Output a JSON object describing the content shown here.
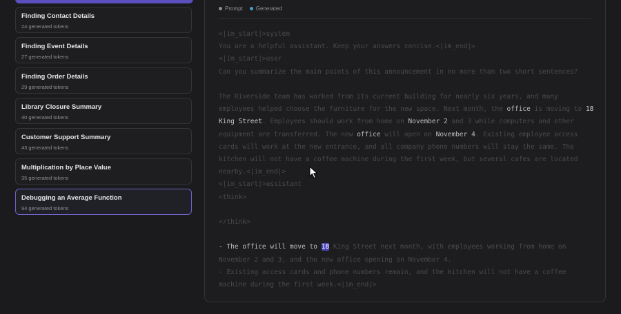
{
  "sidebar": {
    "items": [
      {
        "title": "",
        "subtitle": ""
      },
      {
        "title": "Finding Contact Details",
        "subtitle": "24 generated tokens"
      },
      {
        "title": "Finding Event Details",
        "subtitle": "27 generated tokens"
      },
      {
        "title": "Finding Order Details",
        "subtitle": "29 generated tokens"
      },
      {
        "title": "Library Closure Summary",
        "subtitle": "40 generated tokens"
      },
      {
        "title": "Customer Support Summary",
        "subtitle": "43 generated tokens"
      },
      {
        "title": "Multiplication by Place Value",
        "subtitle": "35 generated tokens"
      },
      {
        "title": "Debugging an Average Function",
        "subtitle": "94 generated tokens"
      }
    ]
  },
  "legend": {
    "prompt": "Prompt",
    "generated": "Generated",
    "prompt_color": "#8e8e93",
    "generated_color": "#3ea6c9"
  },
  "transcript": {
    "l1": "<|im_start|>system",
    "l2": "You are a helpful assistant. Keep your answers concise.<|im_end|>",
    "l3": "<|im_start|>user",
    "l4": "Can you summarize the main points of this announcement in no more than two short sentences?",
    "p1a": "The Riverside team has worked from its current building for nearly six years, and many employees helped choose the furniture for the new space. Next month, the ",
    "p1b": "office",
    "p1c": " is moving to ",
    "p1d": "18 King Street",
    "p1e": ". Employees should work from home on ",
    "p1f": "November 2",
    "p1g": " and 3 while computers and other equipment are transferred. The new ",
    "p1h": "office",
    "p1i": " will open on ",
    "p1j": "November 4",
    "p1k": ". Existing employee access cards will work at the new entrance, and all company phone numbers will stay the same. The kitchen will not have a coffee machine during the first week, but several cafes are located nearby.<|im_end|>",
    "l5": "<|im_start|>assistant",
    "l6": "<think>",
    "l7": "</think>",
    "g1a": "- The ",
    "g1b": "office",
    "g1c": " will move to ",
    "g1d": "18",
    "g1e": " King Street next month, with employees working from home on November 2 and 3, and the new office opening on November 4.",
    "g2": "- Existing access cards and phone numbers remain, and the kitchen will not have a coffee machine during the first week.<|im_end|>"
  }
}
